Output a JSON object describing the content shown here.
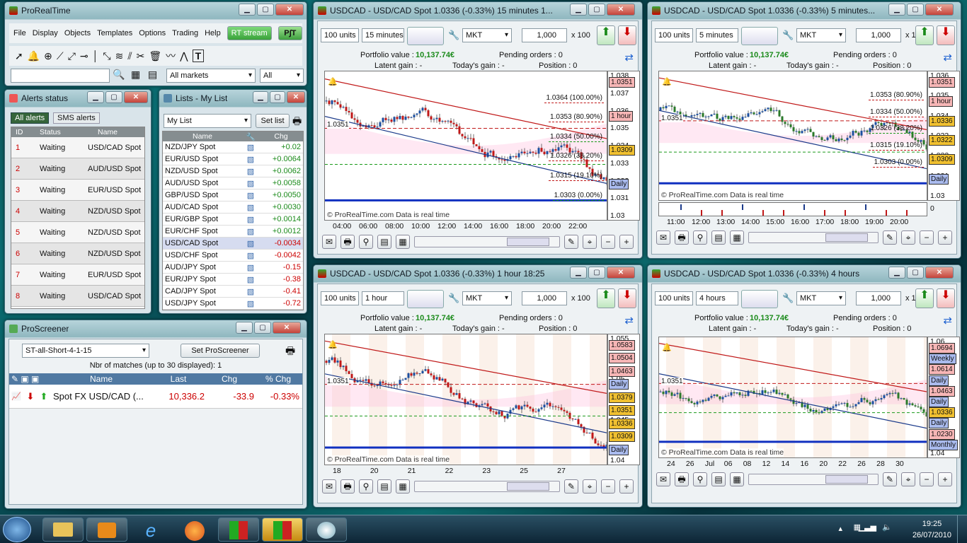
{
  "main_window": {
    "title": "ProRealTime",
    "menu": [
      "File",
      "Display",
      "Objects",
      "Templates",
      "Options",
      "Trading",
      "Help"
    ],
    "rt_stream": "RT stream",
    "market_filter": "All markets",
    "type_filter": "All"
  },
  "alerts": {
    "title": "Alerts status",
    "tab_all": "All alerts",
    "tab_sms": "SMS alerts",
    "col_id": "ID",
    "col_status": "Status",
    "col_name": "Name",
    "rows": [
      {
        "id": "1",
        "status": "Waiting",
        "name": "USD/CAD Spot"
      },
      {
        "id": "2",
        "status": "Waiting",
        "name": "AUD/USD Spot"
      },
      {
        "id": "3",
        "status": "Waiting",
        "name": "EUR/USD Spot"
      },
      {
        "id": "4",
        "status": "Waiting",
        "name": "NZD/USD Spot"
      },
      {
        "id": "5",
        "status": "Waiting",
        "name": "NZD/USD Spot"
      },
      {
        "id": "6",
        "status": "Waiting",
        "name": "NZD/USD Spot"
      },
      {
        "id": "7",
        "status": "Waiting",
        "name": "EUR/USD Spot"
      },
      {
        "id": "8",
        "status": "Waiting",
        "name": "USD/CAD Spot"
      }
    ]
  },
  "lists": {
    "title": "Lists - My List",
    "selected_list": "My List",
    "set_list": "Set list",
    "col_name": "Name",
    "col_chg": "Chg",
    "rows": [
      {
        "name": "NZD/JPY Spot",
        "chg": "+0.02",
        "up": true
      },
      {
        "name": "EUR/USD Spot",
        "chg": "+0.0064",
        "up": true
      },
      {
        "name": "NZD/USD Spot",
        "chg": "+0.0062",
        "up": true
      },
      {
        "name": "AUD/USD Spot",
        "chg": "+0.0058",
        "up": true
      },
      {
        "name": "GBP/USD Spot",
        "chg": "+0.0050",
        "up": true
      },
      {
        "name": "AUD/CAD Spot",
        "chg": "+0.0030",
        "up": true
      },
      {
        "name": "EUR/GBP Spot",
        "chg": "+0.0014",
        "up": true
      },
      {
        "name": "EUR/CHF Spot",
        "chg": "+0.0012",
        "up": true
      },
      {
        "name": "USD/CAD Spot",
        "chg": "-0.0034",
        "up": false
      },
      {
        "name": "USD/CHF Spot",
        "chg": "-0.0042",
        "up": false
      },
      {
        "name": "AUD/JPY Spot",
        "chg": "-0.15",
        "up": false
      },
      {
        "name": "EUR/JPY Spot",
        "chg": "-0.38",
        "up": false
      },
      {
        "name": "CAD/JPY Spot",
        "chg": "-0.41",
        "up": false
      },
      {
        "name": "USD/JPY Spot",
        "chg": "-0.72",
        "up": false
      }
    ]
  },
  "screener": {
    "title": "ProScreener",
    "selected": "ST-all-Short-4-1-15",
    "set_button": "Set ProScreener",
    "matches": "Nbr of matches (up to 30 displayed): 1",
    "col_name": "Name",
    "col_last": "Last",
    "col_chg": "Chg",
    "col_pct": "% Chg",
    "row": {
      "name": "Spot FX USD/CAD (...",
      "last": "10,336.2",
      "chg": "-33.9",
      "pct": "-0.33%"
    }
  },
  "charts": [
    {
      "title": "USDCAD - USD/CAD Spot   1.0336 (-0.33%)   15 minutes  1...",
      "units": "100 units",
      "period": "15 minutes",
      "order": "MKT",
      "qty": "1,000",
      "mult": "x 100",
      "portfolio_label": "Portfolio value :",
      "portfolio_value": "10,137.74€",
      "pending": "Pending orders : 0",
      "latent": "Latent gain : -",
      "today": "Today's gain : -",
      "position": "Position : 0",
      "watermark": "© ProRealTime.com  Data is real time",
      "y_ticks": [
        "1.038",
        "1.037",
        "1.036",
        "1.035",
        "1.034",
        "1.033",
        "1.032",
        "1.031",
        "1.03"
      ],
      "x_ticks": [
        "04:00",
        "06:00",
        "08:00",
        "10:00",
        "12:00",
        "14:00",
        "16:00",
        "18:00",
        "20:00",
        "22:00"
      ],
      "levels": [
        "1.0364 (100.00%)",
        "1.0353 (80.90%)",
        "1.0334 (50.00%)",
        "1.0326 (38.20%)",
        "1.0315 (19.10%)",
        "1.0303 (0.00%)"
      ],
      "tags": [
        "1.0351",
        "1 hour",
        "1.0309",
        "Daily"
      ],
      "left_tag": "1.0351"
    },
    {
      "title": "USDCAD - USD/CAD Spot   1.0336 (-0.33%)   5 minutes...",
      "units": "100 units",
      "period": "5 minutes",
      "order": "MKT",
      "qty": "1,000",
      "mult": "x 100",
      "portfolio_label": "Portfolio value :",
      "portfolio_value": "10,137.74€",
      "pending": "Pending orders : 0",
      "latent": "Latent gain : -",
      "today": "Today's gain : -",
      "position": "Position : 0",
      "watermark": "© ProRealTime.com  Data is real time",
      "y_ticks": [
        "1.036",
        "1.035",
        "1.034",
        "1.033",
        "1.032",
        "1.031",
        "1.03"
      ],
      "x_ticks": [
        "11:00",
        "12:00",
        "13:00",
        "14:00",
        "15:00",
        "16:00",
        "17:00",
        "18:00",
        "19:00",
        "20:00"
      ],
      "levels": [
        "1.0353 (80.90%)",
        "1.0334 (50.00%)",
        "1.0326 (38.20%)",
        "1.0315 (19.10%)",
        "1.0303 (0.00%)"
      ],
      "tags": [
        "1.0351",
        "1 hour",
        "1.0336",
        "1.0322",
        "1.0309",
        "Daily"
      ],
      "left_tag": "1.0351",
      "sub_zero": "0"
    },
    {
      "title": "USDCAD - USD/CAD Spot   1.0336 (-0.33%)   1 hour  18:25",
      "units": "100 units",
      "period": "1 hour",
      "order": "MKT",
      "qty": "1,000",
      "mult": "x 100",
      "portfolio_label": "Portfolio value :",
      "portfolio_value": "10,137.74€",
      "pending": "Pending orders : 0",
      "latent": "Latent gain : -",
      "today": "Today's gain : -",
      "position": "Position : 0",
      "watermark": "© ProRealTime.com  Data is real time",
      "y_ticks": [
        "1.055",
        "1.05",
        "1.045",
        "1.04"
      ],
      "x_ticks": [
        "18",
        "20",
        "21",
        "22",
        "23",
        "25",
        "27"
      ],
      "tags": [
        "1.0583",
        "1.0504",
        "1.0463",
        "Daily",
        "1.0379",
        "1.0351",
        "1.0336",
        "1.0309",
        "Daily"
      ],
      "left_tag": "1.0351"
    },
    {
      "title": "USDCAD - USD/CAD Spot   1.0336 (-0.33%)   4 hours",
      "units": "100 units",
      "period": "4 hours",
      "order": "MKT",
      "qty": "1,000",
      "mult": "x 100",
      "portfolio_label": "Portfolio value :",
      "portfolio_value": "10,137.74€",
      "pending": "Pending orders : 0",
      "latent": "Latent gain : -",
      "today": "Today's gain : -",
      "position": "Position : 0",
      "watermark": "© ProRealTime.com  Data is real time",
      "y_ticks": [
        "1.06",
        "1.05",
        "1.04"
      ],
      "x_ticks": [
        "24",
        "26",
        "Jul",
        "06",
        "08",
        "12",
        "14",
        "16",
        "20",
        "22",
        "26",
        "28",
        "30"
      ],
      "tags": [
        "1.0694",
        "Weekly",
        "1.0614",
        "Daily",
        "1.0463",
        "Daily",
        "1.0336",
        "Daily",
        "1.0230",
        "Monthly"
      ],
      "left_tag": "1.0351"
    }
  ],
  "taskbar": {
    "time": "19:25",
    "date": "26/07/2010"
  }
}
